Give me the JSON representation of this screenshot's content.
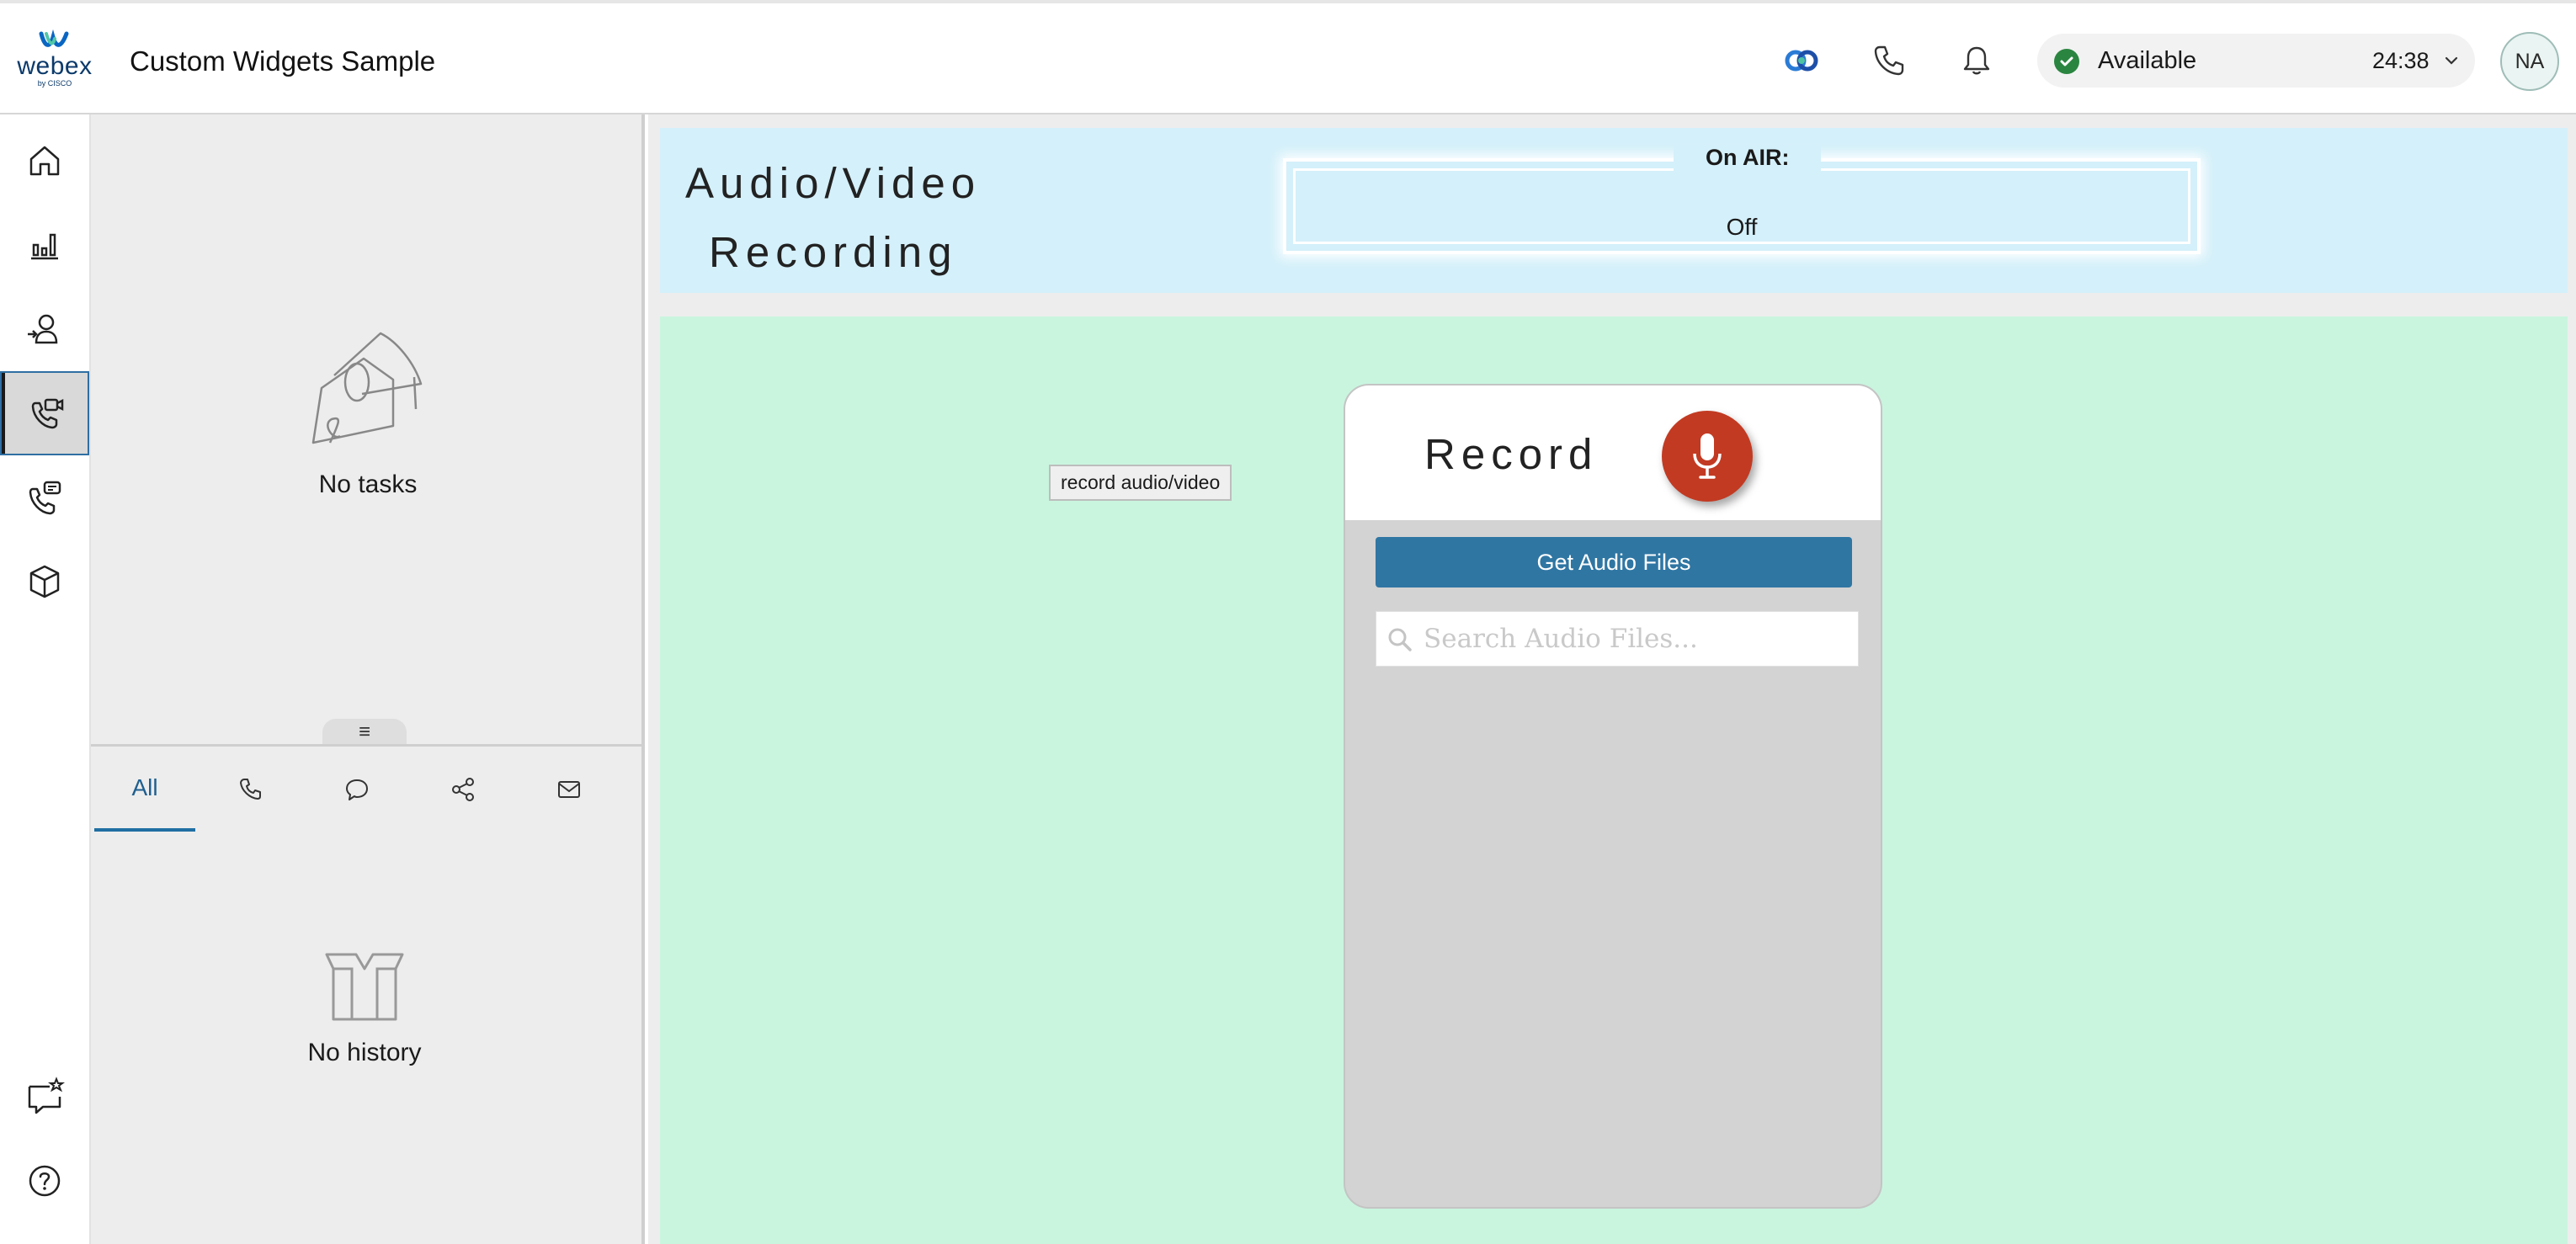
{
  "app": {
    "logo_text": "webex",
    "logo_subtext": "by CISCO",
    "title": "Custom Widgets Sample"
  },
  "header": {
    "icons": [
      "webex-app-icon",
      "phone-icon",
      "bell-icon"
    ],
    "status": {
      "label": "Available",
      "timer": "24:38",
      "color": "#2a8540"
    },
    "avatar_initials": "NA"
  },
  "nav": {
    "items": [
      {
        "icon": "home-icon"
      },
      {
        "icon": "analytics-icon"
      },
      {
        "icon": "agent-login-icon"
      },
      {
        "icon": "video-call-icon",
        "active": true
      },
      {
        "icon": "call-chat-icon"
      },
      {
        "icon": "box-icon"
      }
    ],
    "bottom_items": [
      {
        "icon": "feedback-icon"
      },
      {
        "icon": "help-icon"
      }
    ]
  },
  "tasks": {
    "empty_label": "No tasks",
    "tabs": [
      {
        "label": "All",
        "active": true
      },
      {
        "icon": "phone-icon"
      },
      {
        "icon": "chat-icon"
      },
      {
        "icon": "social-icon"
      },
      {
        "icon": "email-icon"
      }
    ],
    "history_empty_label": "No history"
  },
  "widget": {
    "title_line1": "Audio/Video",
    "title_line2": "Recording",
    "onair_label": "On AIR:",
    "onair_value": "Off",
    "record_label": "Record",
    "tooltip": "record audio/video",
    "get_files_label": "Get Audio Files",
    "search_placeholder": "Search Audio Files...",
    "search_value": ""
  },
  "colors": {
    "accent": "#2f76a3",
    "header_bg": "#d4f0fa",
    "content_bg": "#c9f5df",
    "record_button": "#c23a22"
  }
}
